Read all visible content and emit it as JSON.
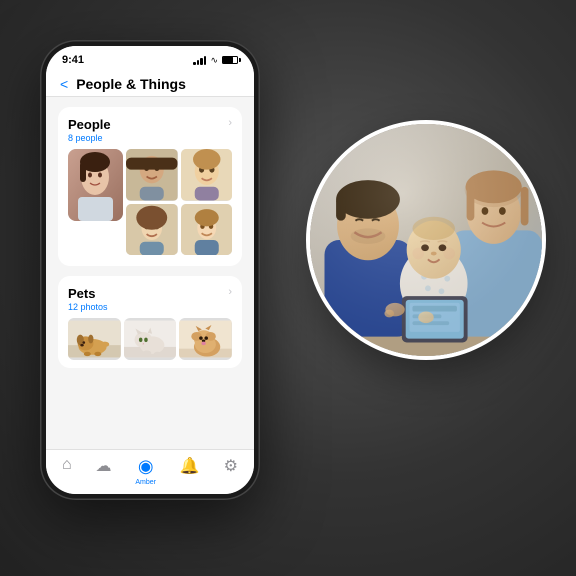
{
  "scene": {
    "background_color": "#3a3a3a"
  },
  "phone": {
    "status_bar": {
      "time": "9:41",
      "signal": "•••",
      "wifi": "wifi",
      "battery": "battery"
    },
    "nav": {
      "back_label": "<",
      "title": "People & Things"
    },
    "sections": [
      {
        "id": "people",
        "title": "People",
        "subtitle": "8 people",
        "chevron": "›",
        "photo_count": 5
      },
      {
        "id": "pets",
        "title": "Pets",
        "subtitle": "12 photos",
        "chevron": "›",
        "photo_count": 3
      }
    ],
    "tab_bar": {
      "items": [
        {
          "id": "home",
          "icon": "⌂",
          "label": "",
          "active": false
        },
        {
          "id": "cloud",
          "icon": "☁",
          "label": "",
          "active": false
        },
        {
          "id": "amber",
          "icon": "◉",
          "label": "Amber",
          "active": true
        },
        {
          "id": "bell",
          "icon": "🔔",
          "label": "",
          "active": false
        },
        {
          "id": "gear",
          "icon": "⚙",
          "label": "",
          "active": false
        }
      ]
    }
  },
  "family_photo": {
    "alt": "Family with baby looking at tablet"
  }
}
